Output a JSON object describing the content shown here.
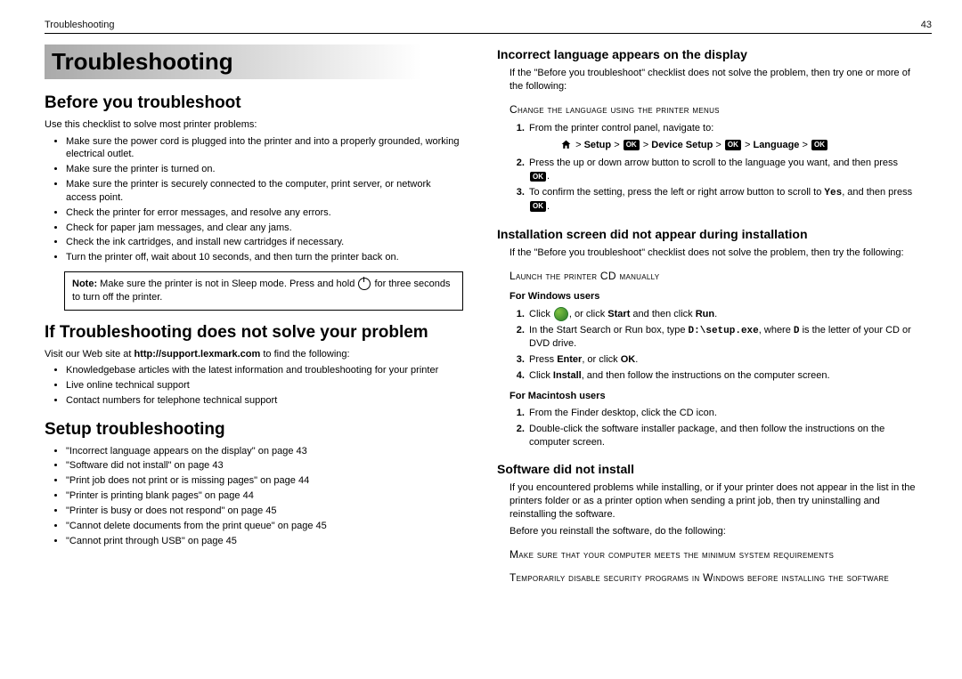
{
  "header": {
    "section": "Troubleshooting",
    "page": "43"
  },
  "chapter": "Troubleshooting",
  "left": {
    "h_before": "Before you troubleshoot",
    "before_intro": "Use this checklist to solve most printer problems:",
    "before_list": [
      "Make sure the power cord is plugged into the printer and into a properly grounded, working electrical outlet.",
      "Make sure the printer is turned on.",
      "Make sure the printer is securely connected to the computer, print server, or network access point.",
      "Check the printer for error messages, and resolve any errors.",
      "Check for paper jam messages, and clear any jams.",
      "Check the ink cartridges, and install new cartridges if necessary.",
      "Turn the printer off, wait about 10 seconds, and then turn the printer back on."
    ],
    "note_prefix": "Note:",
    "note_text1": " Make sure the printer is not in Sleep mode. Press and hold ",
    "note_text2": " for three seconds to turn off the printer.",
    "h_if": "If Troubleshooting does not solve your problem",
    "if_intro1": "Visit our Web site at ",
    "if_url": "http://support.lexmark.com",
    "if_intro2": " to find the following:",
    "if_list": [
      "Knowledgebase articles with the latest information and troubleshooting for your printer",
      "Live online technical support",
      "Contact numbers for telephone technical support"
    ],
    "h_setup": "Setup troubleshooting",
    "setup_list": [
      "\"Incorrect language appears on the display\" on page 43",
      "\"Software did not install\" on page 43",
      "\"Print job does not print or is missing pages\" on page 44",
      "\"Printer is printing blank pages\" on page 44",
      "\"Printer is busy or does not respond\" on page 45",
      "\"Cannot delete documents from the print queue\" on page 45",
      "\"Cannot print through USB\" on page 45"
    ]
  },
  "right": {
    "h_lang": "Incorrect language appears on the display",
    "lang_intro": "If the \"Before you troubleshoot\" checklist does not solve the problem, then try one or more of the following:",
    "lang_sub": "Change the language using the printer menus",
    "lang_step1": "From the printer control panel, navigate to:",
    "nav": {
      "setup": "Setup",
      "device": "Device Setup",
      "language": "Language",
      "gt": ">"
    },
    "lang_step2a": "Press the up or down arrow button to scroll to the language you want, and then press ",
    "lang_step3a": "To confirm the setting, press the left or right arrow button to scroll to ",
    "lang_yes": "Yes",
    "lang_step3b": ", and then press ",
    "ok": "OK",
    "h_install": "Installation screen did not appear during installation",
    "install_intro": "If the \"Before you troubleshoot\" checklist does not solve the problem, then try the following:",
    "install_sub": "Launch the printer CD manually",
    "win_head": "For Windows users",
    "win1a": "Click ",
    "win1b": ", or click ",
    "win1c": "Start",
    "win1d": " and then click ",
    "win1e": "Run",
    "win2a": "In the Start Search or Run box, type ",
    "win2b": "D:\\setup.exe",
    "win2c": ", where ",
    "win2d": "D",
    "win2e": " is the letter of your CD or DVD drive.",
    "win3a": "Press ",
    "win3b": "Enter",
    "win3c": ", or click ",
    "win3d": "OK",
    "win4a": "Click ",
    "win4b": "Install",
    "win4c": ", and then follow the instructions on the computer screen.",
    "mac_head": "For Macintosh users",
    "mac1": "From the Finder desktop, click the CD icon.",
    "mac2": "Double-click the software installer package, and then follow the instructions on the computer screen.",
    "h_soft": "Software did not install",
    "soft_intro": "If you encountered problems while installing, or if your printer does not appear in the list in the printers folder or as a printer option when sending a print job, then try uninstalling and reinstalling the software.",
    "soft_intro2": "Before you reinstall the software, do the following:",
    "soft_sub1": "Make sure that your computer meets the minimum system requirements",
    "soft_sub2": "Temporarily disable security programs in Windows before installing the software"
  }
}
